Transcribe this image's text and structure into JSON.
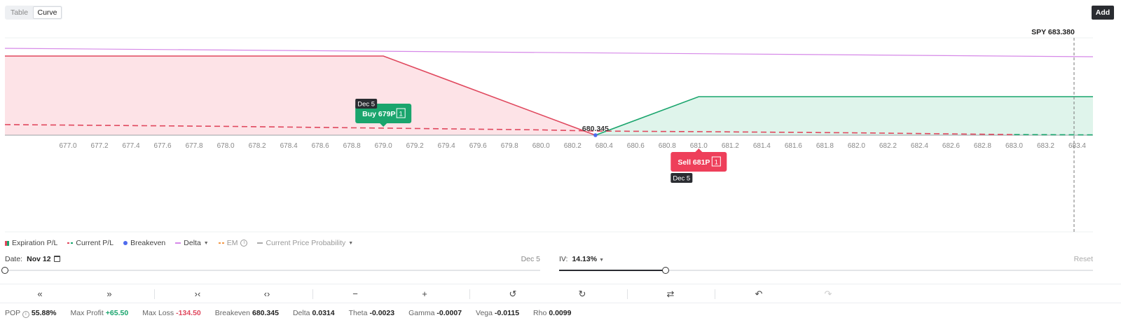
{
  "view_toggle": {
    "table_label": "Table",
    "curve_label": "Curve",
    "active": "Curve"
  },
  "add_label": "Add",
  "spot": {
    "label": "SPY 683.380",
    "value": 683.38
  },
  "chart_data": {
    "type": "line",
    "x_ticks": [
      677.0,
      677.2,
      677.4,
      677.6,
      677.8,
      678.0,
      678.2,
      678.4,
      678.6,
      678.8,
      679.0,
      679.2,
      679.4,
      679.6,
      679.8,
      680.0,
      680.2,
      680.4,
      680.6,
      680.8,
      681.0,
      681.2,
      681.4,
      681.6,
      681.8,
      682.0,
      682.2,
      682.4,
      682.6,
      682.8,
      683.0,
      683.2,
      683.4
    ],
    "x_tick_labels": [
      "677.0",
      "677.2",
      "677.4",
      "677.6",
      "677.8",
      "678.0",
      "678.2",
      "678.4",
      "678.6",
      "678.8",
      "679.0",
      "679.2",
      "679.4",
      "679.6",
      "679.8",
      "680.0",
      "680.2",
      "680.4",
      "680.6",
      "680.8",
      "681.0",
      "681.2",
      "681.4",
      "681.6",
      "681.8",
      "682.0",
      "682.2",
      "682.4",
      "682.6",
      "682.8",
      "683.0",
      "683.2",
      "683.4"
    ],
    "xlim": [
      676.6,
      683.5
    ],
    "ylim": [
      -134.5,
      65.5
    ],
    "expiration_pl": [
      [
        676.6,
        -134.5
      ],
      [
        679.0,
        -134.5
      ],
      [
        681.0,
        65.5
      ],
      [
        683.5,
        65.5
      ]
    ],
    "current_pl": [
      [
        676.6,
        -18
      ],
      [
        678.0,
        -15
      ],
      [
        679.0,
        -12
      ],
      [
        680.0,
        -9
      ],
      [
        680.345,
        -7
      ],
      [
        681.0,
        -6
      ],
      [
        682.0,
        -4
      ],
      [
        683.0,
        -1
      ],
      [
        683.5,
        0.5
      ]
    ],
    "delta_line": [
      [
        676.6,
        0.9
      ],
      [
        683.5,
        0.78
      ]
    ],
    "breakeven": {
      "x": 680.345,
      "label": "680.345"
    },
    "legs": [
      {
        "label": "Buy 679P",
        "qty": "1",
        "expiry": "Dec 5",
        "strike": 679.0,
        "side": "buy"
      },
      {
        "label": "Sell 681P",
        "qty": "1",
        "expiry": "Dec 5",
        "strike": 681.0,
        "side": "sell"
      }
    ]
  },
  "legend": {
    "expiration": "Expiration P/L",
    "current": "Current P/L",
    "breakeven": "Breakeven",
    "delta": "Delta",
    "em": "EM",
    "cpp": "Current Price Probability"
  },
  "date_control": {
    "label": "Date:",
    "value": "Nov 12",
    "end": "Dec 5",
    "position": 0
  },
  "iv_control": {
    "label": "IV:",
    "value": "14.13%",
    "reset": "Reset",
    "position": 0.2
  },
  "toolbar": {
    "items": [
      "double-left-icon",
      "double-right-icon",
      "collapse-icon",
      "expand-icon",
      "minus-icon",
      "plus-icon",
      "history-back-icon",
      "history-forward-icon",
      "swap-icon",
      "undo-icon",
      "redo-icon"
    ],
    "glyphs": [
      "«",
      "»",
      "›‹",
      "‹›",
      "−",
      "+",
      "↺",
      "↻",
      "⇄",
      "↶",
      "↷"
    ]
  },
  "stats": {
    "pop_label": "POP",
    "pop": "55.88%",
    "max_profit_label": "Max Profit",
    "max_profit": "+65.50",
    "max_loss_label": "Max Loss",
    "max_loss": "-134.50",
    "breakeven_label": "Breakeven",
    "breakeven": "680.345",
    "delta_label": "Delta",
    "delta": "0.0314",
    "theta_label": "Theta",
    "theta": "-0.0023",
    "gamma_label": "Gamma",
    "gamma": "-0.0007",
    "vega_label": "Vega",
    "vega": "-0.0115",
    "rho_label": "Rho",
    "rho": "0.0099"
  }
}
